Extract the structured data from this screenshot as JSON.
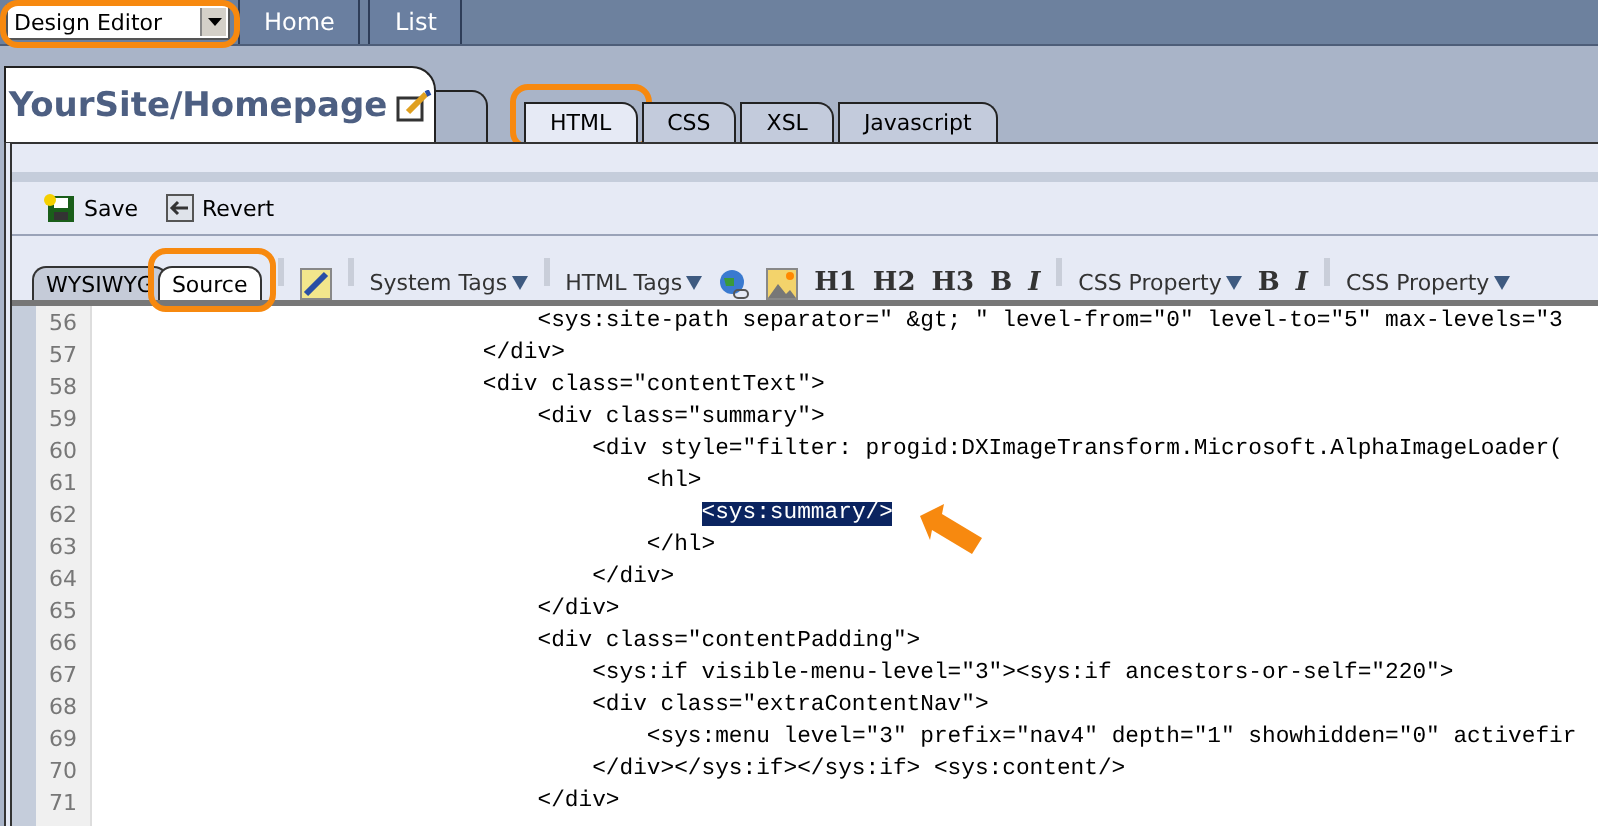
{
  "top_bar": {
    "mode_select": {
      "value": "Design Editor",
      "highlighted": true
    },
    "nav_buttons": [
      "Home",
      "List"
    ]
  },
  "page_tab": {
    "title": "YourSite/Homepage"
  },
  "file_tabs": [
    {
      "label": "HTML",
      "selected": true,
      "highlighted": true
    },
    {
      "label": "CSS",
      "selected": false,
      "highlighted": false
    },
    {
      "label": "XSL",
      "selected": false,
      "highlighted": false
    },
    {
      "label": "Javascript",
      "selected": false,
      "highlighted": false
    }
  ],
  "actions": [
    {
      "kind": "save",
      "label": "Save"
    },
    {
      "kind": "revert",
      "label": "Revert"
    }
  ],
  "view_tabs": [
    {
      "label": "WYSIWYG",
      "selected": false,
      "highlighted": false
    },
    {
      "label": "Source",
      "selected": true,
      "highlighted": true
    }
  ],
  "toolbar": [
    {
      "kind": "sep"
    },
    {
      "kind": "pen"
    },
    {
      "kind": "sep"
    },
    {
      "kind": "dropdown",
      "label": "System Tags"
    },
    {
      "kind": "sep"
    },
    {
      "kind": "dropdown",
      "label": "HTML Tags"
    },
    {
      "kind": "globe"
    },
    {
      "kind": "image"
    },
    {
      "kind": "heading",
      "label": "H1"
    },
    {
      "kind": "heading",
      "label": "H2"
    },
    {
      "kind": "heading",
      "label": "H3"
    },
    {
      "kind": "bold",
      "label": "B"
    },
    {
      "kind": "italic",
      "label": "I"
    },
    {
      "kind": "sep"
    },
    {
      "kind": "dropdown",
      "label": "CSS Property"
    },
    {
      "kind": "bold",
      "label": "B"
    },
    {
      "kind": "italic",
      "label": "I"
    },
    {
      "kind": "sep"
    },
    {
      "kind": "dropdown",
      "label": "CSS Property"
    }
  ],
  "code": [
    {
      "number": "56",
      "text": "                                <sys:site-path separator=\" &gt; \" level-from=\"0\" level-to=\"5\" max-levels=\"3",
      "selected": false
    },
    {
      "number": "57",
      "text": "                            </div>",
      "selected": false
    },
    {
      "number": "58",
      "text": "                            <div class=\"contentText\">",
      "selected": false
    },
    {
      "number": "59",
      "text": "                                <div class=\"summary\">",
      "selected": false
    },
    {
      "number": "60",
      "text": "                                    <div style=\"filter: progid:DXImageTransform.Microsoft.AlphaImageLoader(",
      "selected": false
    },
    {
      "number": "61",
      "text": "                                        <hl>",
      "selected": false
    },
    {
      "number": "62",
      "text": "                                            <sys:summary/>",
      "selected": true
    },
    {
      "number": "63",
      "text": "                                        </hl>",
      "selected": false
    },
    {
      "number": "64",
      "text": "                                    </div>",
      "selected": false
    },
    {
      "number": "65",
      "text": "                                </div>",
      "selected": false
    },
    {
      "number": "66",
      "text": "                                <div class=\"contentPadding\">",
      "selected": false
    },
    {
      "number": "67",
      "text": "                                    <sys:if visible-menu-level=\"3\"><sys:if ancestors-or-self=\"220\">",
      "selected": false
    },
    {
      "number": "68",
      "text": "                                    <div class=\"extraContentNav\">",
      "selected": false
    },
    {
      "number": "69",
      "text": "                                        <sys:menu level=\"3\" prefix=\"nav4\" depth=\"1\" showhidden=\"0\" activefir",
      "selected": false
    },
    {
      "number": "70",
      "text": "                                    </div></sys:if></sys:if> <sys:content/>",
      "selected": false
    },
    {
      "number": "71",
      "text": "                                </div>",
      "selected": false
    }
  ]
}
